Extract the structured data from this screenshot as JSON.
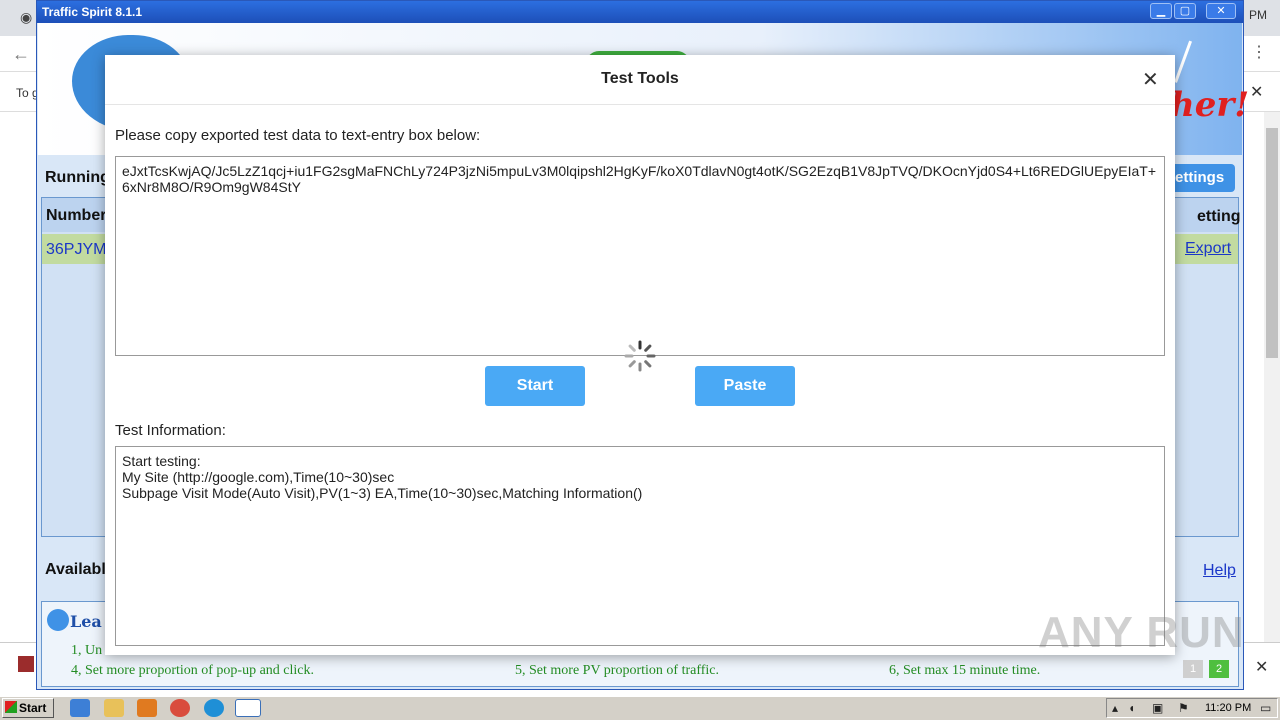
{
  "browser": {
    "infobar_text": "To g",
    "back_glyph": "←",
    "menu_glyph": "⋮",
    "close_glyph": "✕",
    "pm_label": "PM"
  },
  "app": {
    "title": "Traffic Spirit 8.1.1",
    "controls": {
      "minimize": "▁",
      "maximize": "▢",
      "close": "✕"
    },
    "slogan": "her!",
    "running_label": "Running",
    "settings_button": "ettings",
    "table": {
      "col_number": "Number",
      "col_setting": "etting",
      "row_number": "36PJYM",
      "row_export": "Export"
    },
    "available_label": "Availabl",
    "help_link": "Help",
    "learn_title": "Lea",
    "learn_items": [
      "1, Un",
      "4, Set more proportion of pop-up and click.",
      "5, Set more PV proportion of traffic.",
      "6, Set max 15 minute time."
    ],
    "pages": [
      "1",
      "2"
    ]
  },
  "modal": {
    "title": "Test Tools",
    "close_glyph": "✕",
    "copy_label": "Please copy exported test data to text-entry box below:",
    "data_text": "eJxtTcsKwjAQ/Jc5LzZ1qcj+iu1FG2sgMaFNChLy724P3jzNi5mpuLv3M0lqipshl2HgKyF/koX0TdlavN0gt4otK/SG2EzqB1V8JpTVQ/DKOcnYjd0S4+Lt6REDGlUEpyEIaT+6xNr8M8O/R9Om9gW84StY",
    "start_button": "Start",
    "paste_button": "Paste",
    "info_label": "Test Information:",
    "info_text": "Start testing:\nMy Site (http://google.com),Time(10~30)sec\nSubpage Visit Mode(Auto Visit),PV(1~3) EA,Time(10~30)sec,Matching Information()",
    "watermark": "ANY RUN"
  },
  "taskbar": {
    "start_label": "Start",
    "time": "11:20 PM"
  },
  "colors": {
    "button_blue": "#4aa9f5",
    "title_blue": "#2c6fe0",
    "link_blue": "#1b37c8",
    "learn_green": "#238c23"
  }
}
